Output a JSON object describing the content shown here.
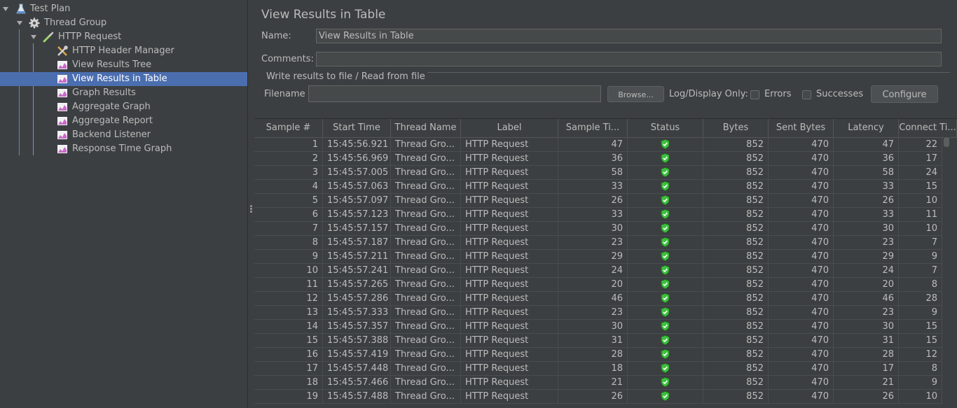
{
  "tree": {
    "items": [
      {
        "label": "Test Plan",
        "icon": "flask-icon"
      },
      {
        "label": "Thread Group",
        "icon": "gear-icon"
      },
      {
        "label": "HTTP Request",
        "icon": "pipette-icon"
      },
      {
        "label": "HTTP Header Manager",
        "icon": "tools-icon"
      },
      {
        "label": "View Results Tree",
        "icon": "chart-icon"
      },
      {
        "label": "View Results in Table",
        "icon": "chart-icon"
      },
      {
        "label": "Graph Results",
        "icon": "chart-icon"
      },
      {
        "label": "Aggregate Graph",
        "icon": "chart-icon"
      },
      {
        "label": "Aggregate Report",
        "icon": "chart-icon"
      },
      {
        "label": "Backend Listener",
        "icon": "chart-icon"
      },
      {
        "label": "Response Time Graph",
        "icon": "chart-icon"
      }
    ],
    "selected": "View Results in Table"
  },
  "panel": {
    "title": "View Results in Table",
    "name_label": "Name:",
    "name_value": "View Results in Table",
    "comments_label": "Comments:",
    "comments_value": "",
    "file_group_title": "Write results to file / Read from file",
    "filename_label": "Filename",
    "filename_value": "",
    "browse_label": "Browse...",
    "log_display_label": "Log/Display Only:",
    "errors_label": "Errors",
    "successes_label": "Successes",
    "configure_label": "Configure"
  },
  "table": {
    "columns": [
      "Sample #",
      "Start Time",
      "Thread Name",
      "Label",
      "Sample Ti...",
      "Status",
      "Bytes",
      "Sent Bytes",
      "Latency",
      "Connect Ti..."
    ],
    "rows": [
      [
        "1",
        "15:45:56.921",
        "Thread Gro...",
        "HTTP Request",
        "47",
        "success",
        "852",
        "470",
        "47",
        "22"
      ],
      [
        "2",
        "15:45:56.969",
        "Thread Gro...",
        "HTTP Request",
        "36",
        "success",
        "852",
        "470",
        "36",
        "17"
      ],
      [
        "3",
        "15:45:57.005",
        "Thread Gro...",
        "HTTP Request",
        "58",
        "success",
        "852",
        "470",
        "58",
        "24"
      ],
      [
        "4",
        "15:45:57.063",
        "Thread Gro...",
        "HTTP Request",
        "33",
        "success",
        "852",
        "470",
        "33",
        "15"
      ],
      [
        "5",
        "15:45:57.097",
        "Thread Gro...",
        "HTTP Request",
        "26",
        "success",
        "852",
        "470",
        "26",
        "10"
      ],
      [
        "6",
        "15:45:57.123",
        "Thread Gro...",
        "HTTP Request",
        "33",
        "success",
        "852",
        "470",
        "33",
        "11"
      ],
      [
        "7",
        "15:45:57.157",
        "Thread Gro...",
        "HTTP Request",
        "30",
        "success",
        "852",
        "470",
        "30",
        "10"
      ],
      [
        "8",
        "15:45:57.187",
        "Thread Gro...",
        "HTTP Request",
        "23",
        "success",
        "852",
        "470",
        "23",
        "7"
      ],
      [
        "9",
        "15:45:57.211",
        "Thread Gro...",
        "HTTP Request",
        "29",
        "success",
        "852",
        "470",
        "29",
        "9"
      ],
      [
        "10",
        "15:45:57.241",
        "Thread Gro...",
        "HTTP Request",
        "24",
        "success",
        "852",
        "470",
        "24",
        "7"
      ],
      [
        "11",
        "15:45:57.265",
        "Thread Gro...",
        "HTTP Request",
        "20",
        "success",
        "852",
        "470",
        "20",
        "8"
      ],
      [
        "12",
        "15:45:57.286",
        "Thread Gro...",
        "HTTP Request",
        "46",
        "success",
        "852",
        "470",
        "46",
        "28"
      ],
      [
        "13",
        "15:45:57.333",
        "Thread Gro...",
        "HTTP Request",
        "23",
        "success",
        "852",
        "470",
        "23",
        "9"
      ],
      [
        "14",
        "15:45:57.357",
        "Thread Gro...",
        "HTTP Request",
        "30",
        "success",
        "852",
        "470",
        "30",
        "15"
      ],
      [
        "15",
        "15:45:57.388",
        "Thread Gro...",
        "HTTP Request",
        "31",
        "success",
        "852",
        "470",
        "31",
        "15"
      ],
      [
        "16",
        "15:45:57.419",
        "Thread Gro...",
        "HTTP Request",
        "28",
        "success",
        "852",
        "470",
        "28",
        "12"
      ],
      [
        "17",
        "15:45:57.448",
        "Thread Gro...",
        "HTTP Request",
        "18",
        "success",
        "852",
        "470",
        "17",
        "8"
      ],
      [
        "18",
        "15:45:57.466",
        "Thread Gro...",
        "HTTP Request",
        "21",
        "success",
        "852",
        "470",
        "21",
        "9"
      ],
      [
        "19",
        "15:45:57.488",
        "Thread Gro...",
        "HTTP Request",
        "26",
        "success",
        "852",
        "470",
        "26",
        "10"
      ]
    ]
  },
  "colors": {
    "background": "#3c3f41",
    "selection": "#4b6eaf",
    "text": "#bbbbbb",
    "success_green": "#3fbf3f"
  }
}
